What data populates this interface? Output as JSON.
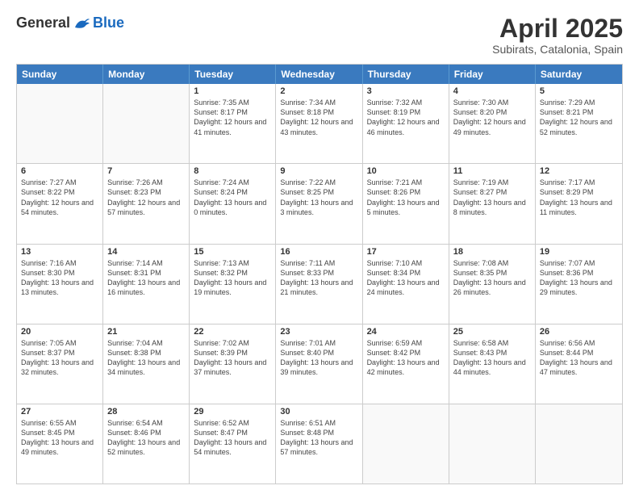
{
  "logo": {
    "general": "General",
    "blue": "Blue"
  },
  "title": "April 2025",
  "subtitle": "Subirats, Catalonia, Spain",
  "header_days": [
    "Sunday",
    "Monday",
    "Tuesday",
    "Wednesday",
    "Thursday",
    "Friday",
    "Saturday"
  ],
  "rows": [
    [
      {
        "day": "",
        "empty": true
      },
      {
        "day": "",
        "empty": true
      },
      {
        "day": "1",
        "sunrise": "Sunrise: 7:35 AM",
        "sunset": "Sunset: 8:17 PM",
        "daylight": "Daylight: 12 hours and 41 minutes."
      },
      {
        "day": "2",
        "sunrise": "Sunrise: 7:34 AM",
        "sunset": "Sunset: 8:18 PM",
        "daylight": "Daylight: 12 hours and 43 minutes."
      },
      {
        "day": "3",
        "sunrise": "Sunrise: 7:32 AM",
        "sunset": "Sunset: 8:19 PM",
        "daylight": "Daylight: 12 hours and 46 minutes."
      },
      {
        "day": "4",
        "sunrise": "Sunrise: 7:30 AM",
        "sunset": "Sunset: 8:20 PM",
        "daylight": "Daylight: 12 hours and 49 minutes."
      },
      {
        "day": "5",
        "sunrise": "Sunrise: 7:29 AM",
        "sunset": "Sunset: 8:21 PM",
        "daylight": "Daylight: 12 hours and 52 minutes."
      }
    ],
    [
      {
        "day": "6",
        "sunrise": "Sunrise: 7:27 AM",
        "sunset": "Sunset: 8:22 PM",
        "daylight": "Daylight: 12 hours and 54 minutes."
      },
      {
        "day": "7",
        "sunrise": "Sunrise: 7:26 AM",
        "sunset": "Sunset: 8:23 PM",
        "daylight": "Daylight: 12 hours and 57 minutes."
      },
      {
        "day": "8",
        "sunrise": "Sunrise: 7:24 AM",
        "sunset": "Sunset: 8:24 PM",
        "daylight": "Daylight: 13 hours and 0 minutes."
      },
      {
        "day": "9",
        "sunrise": "Sunrise: 7:22 AM",
        "sunset": "Sunset: 8:25 PM",
        "daylight": "Daylight: 13 hours and 3 minutes."
      },
      {
        "day": "10",
        "sunrise": "Sunrise: 7:21 AM",
        "sunset": "Sunset: 8:26 PM",
        "daylight": "Daylight: 13 hours and 5 minutes."
      },
      {
        "day": "11",
        "sunrise": "Sunrise: 7:19 AM",
        "sunset": "Sunset: 8:27 PM",
        "daylight": "Daylight: 13 hours and 8 minutes."
      },
      {
        "day": "12",
        "sunrise": "Sunrise: 7:17 AM",
        "sunset": "Sunset: 8:29 PM",
        "daylight": "Daylight: 13 hours and 11 minutes."
      }
    ],
    [
      {
        "day": "13",
        "sunrise": "Sunrise: 7:16 AM",
        "sunset": "Sunset: 8:30 PM",
        "daylight": "Daylight: 13 hours and 13 minutes."
      },
      {
        "day": "14",
        "sunrise": "Sunrise: 7:14 AM",
        "sunset": "Sunset: 8:31 PM",
        "daylight": "Daylight: 13 hours and 16 minutes."
      },
      {
        "day": "15",
        "sunrise": "Sunrise: 7:13 AM",
        "sunset": "Sunset: 8:32 PM",
        "daylight": "Daylight: 13 hours and 19 minutes."
      },
      {
        "day": "16",
        "sunrise": "Sunrise: 7:11 AM",
        "sunset": "Sunset: 8:33 PM",
        "daylight": "Daylight: 13 hours and 21 minutes."
      },
      {
        "day": "17",
        "sunrise": "Sunrise: 7:10 AM",
        "sunset": "Sunset: 8:34 PM",
        "daylight": "Daylight: 13 hours and 24 minutes."
      },
      {
        "day": "18",
        "sunrise": "Sunrise: 7:08 AM",
        "sunset": "Sunset: 8:35 PM",
        "daylight": "Daylight: 13 hours and 26 minutes."
      },
      {
        "day": "19",
        "sunrise": "Sunrise: 7:07 AM",
        "sunset": "Sunset: 8:36 PM",
        "daylight": "Daylight: 13 hours and 29 minutes."
      }
    ],
    [
      {
        "day": "20",
        "sunrise": "Sunrise: 7:05 AM",
        "sunset": "Sunset: 8:37 PM",
        "daylight": "Daylight: 13 hours and 32 minutes."
      },
      {
        "day": "21",
        "sunrise": "Sunrise: 7:04 AM",
        "sunset": "Sunset: 8:38 PM",
        "daylight": "Daylight: 13 hours and 34 minutes."
      },
      {
        "day": "22",
        "sunrise": "Sunrise: 7:02 AM",
        "sunset": "Sunset: 8:39 PM",
        "daylight": "Daylight: 13 hours and 37 minutes."
      },
      {
        "day": "23",
        "sunrise": "Sunrise: 7:01 AM",
        "sunset": "Sunset: 8:40 PM",
        "daylight": "Daylight: 13 hours and 39 minutes."
      },
      {
        "day": "24",
        "sunrise": "Sunrise: 6:59 AM",
        "sunset": "Sunset: 8:42 PM",
        "daylight": "Daylight: 13 hours and 42 minutes."
      },
      {
        "day": "25",
        "sunrise": "Sunrise: 6:58 AM",
        "sunset": "Sunset: 8:43 PM",
        "daylight": "Daylight: 13 hours and 44 minutes."
      },
      {
        "day": "26",
        "sunrise": "Sunrise: 6:56 AM",
        "sunset": "Sunset: 8:44 PM",
        "daylight": "Daylight: 13 hours and 47 minutes."
      }
    ],
    [
      {
        "day": "27",
        "sunrise": "Sunrise: 6:55 AM",
        "sunset": "Sunset: 8:45 PM",
        "daylight": "Daylight: 13 hours and 49 minutes."
      },
      {
        "day": "28",
        "sunrise": "Sunrise: 6:54 AM",
        "sunset": "Sunset: 8:46 PM",
        "daylight": "Daylight: 13 hours and 52 minutes."
      },
      {
        "day": "29",
        "sunrise": "Sunrise: 6:52 AM",
        "sunset": "Sunset: 8:47 PM",
        "daylight": "Daylight: 13 hours and 54 minutes."
      },
      {
        "day": "30",
        "sunrise": "Sunrise: 6:51 AM",
        "sunset": "Sunset: 8:48 PM",
        "daylight": "Daylight: 13 hours and 57 minutes."
      },
      {
        "day": "",
        "empty": true
      },
      {
        "day": "",
        "empty": true
      },
      {
        "day": "",
        "empty": true
      }
    ]
  ]
}
